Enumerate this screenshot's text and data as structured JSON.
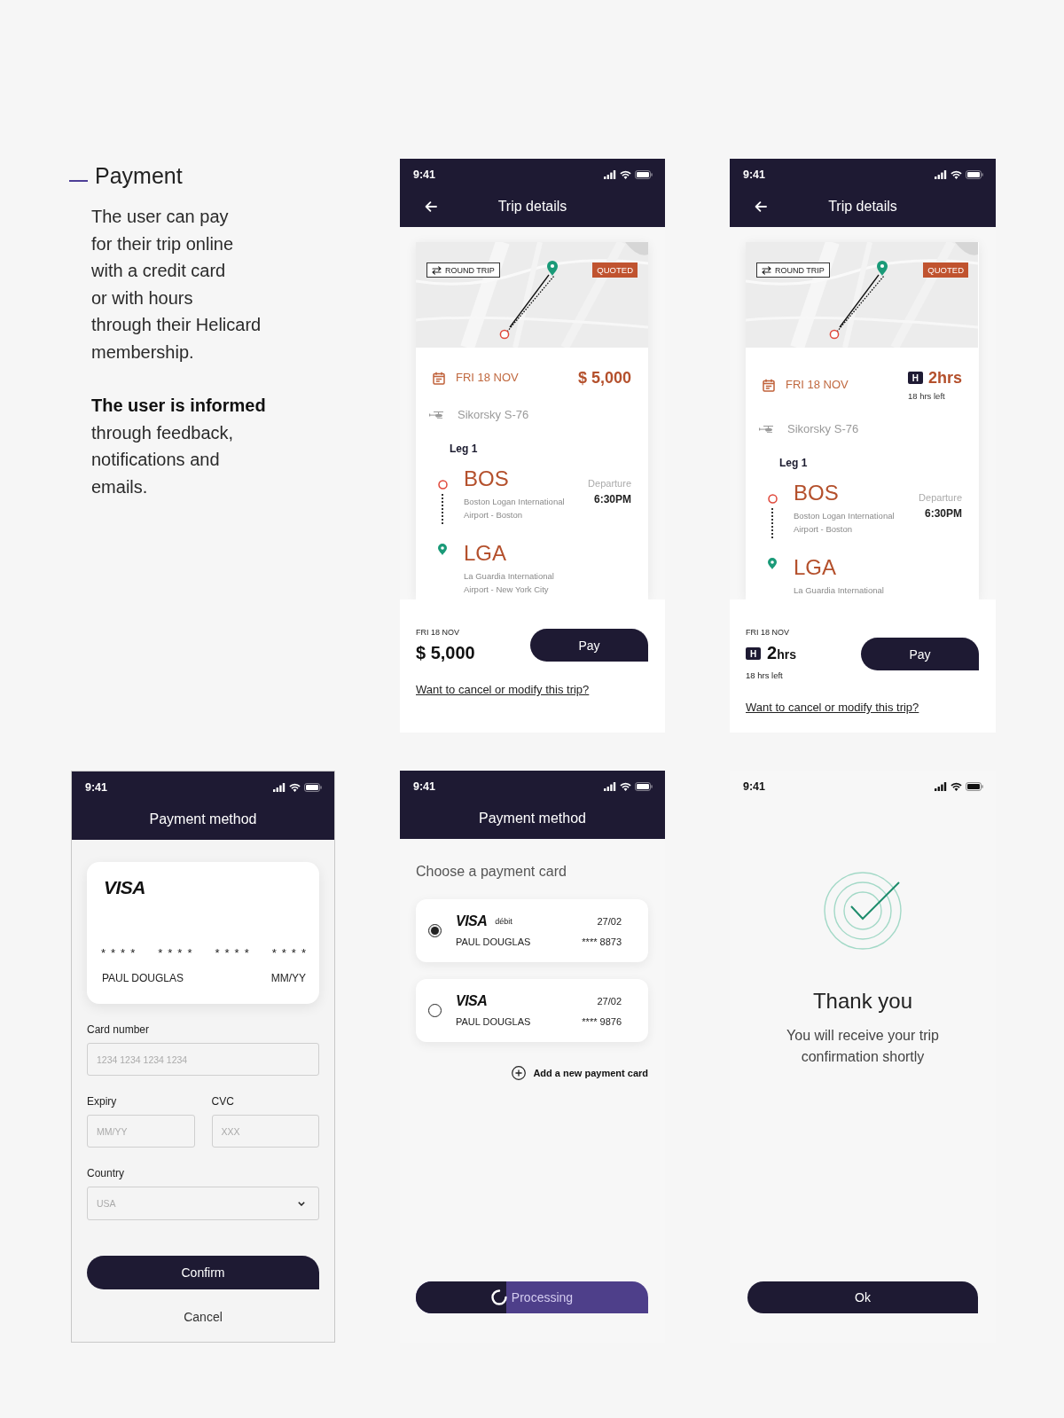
{
  "intro": {
    "title": "Payment",
    "paragraphs": [
      {
        "lines": [
          "The user can pay",
          "for their trip online",
          "with a credit card",
          "or with hours",
          "through their Helicard",
          "membership."
        ]
      },
      {
        "lines": [
          "**The user is informed**",
          "through feedback,",
          "notifications and",
          "emails."
        ]
      }
    ]
  },
  "screens": [
    {
      "kind": "trip_details",
      "status_time": "9:41",
      "title": "Trip details",
      "map": {
        "trip_type": "ROUND TRIP",
        "status": "QUOTED"
      },
      "date": "FRI 18 NOV",
      "cost": {
        "kind": "price",
        "amount": "$ 5,000"
      },
      "aircraft": "Sikorsky S-76",
      "leg": "Leg 1",
      "stops": [
        {
          "kind": "origin",
          "code": "BOS",
          "name_lines": [
            "Boston Logan International",
            "Airport - Boston"
          ],
          "time_label": "Departure",
          "time": "6:30PM"
        },
        {
          "kind": "destination",
          "code": "LGA",
          "name_lines": [
            "La Guardia International",
            "Airport - New York City"
          ]
        }
      ],
      "footer": {
        "date": "FRI 18 NOV",
        "cost": {
          "kind": "price",
          "amount": "$ 5,000"
        },
        "button": "Pay",
        "link": "Want to cancel or modify this trip?"
      }
    },
    {
      "kind": "trip_details",
      "status_time": "9:41",
      "title": "Trip details",
      "map": {
        "trip_type": "ROUND TRIP",
        "status": "QUOTED"
      },
      "date": "FRI 18 NOV",
      "cost": {
        "kind": "hours",
        "badge": "H",
        "value": "2",
        "unit": "hrs",
        "note": "18 hrs left"
      },
      "aircraft": "Sikorsky S-76",
      "leg": "Leg 1",
      "stops": [
        {
          "kind": "origin",
          "code": "BOS",
          "name_lines": [
            "Boston Logan International",
            "Airport - Boston"
          ],
          "time_label": "Departure",
          "time": "6:30PM"
        },
        {
          "kind": "destination",
          "code": "LGA",
          "name_lines": [
            "La Guardia International"
          ]
        }
      ],
      "footer": {
        "date": "FRI 18 NOV",
        "cost": {
          "kind": "hours",
          "badge": "H",
          "value": "2",
          "unit": "hrs",
          "note": "18 hrs left"
        },
        "button": "Pay",
        "link": "Want to cancel or modify this trip?"
      }
    },
    {
      "kind": "card_form",
      "status_time": "9:41",
      "title": "Payment method",
      "card": {
        "brand": "VISA",
        "number_groups": [
          "****",
          "****",
          "****",
          "****"
        ],
        "holder": "PAUL DOUGLAS",
        "expiry": "MM/YY"
      },
      "field_rows": [
        [
          {
            "kind": "text",
            "label": "Card number",
            "placeholder": "1234 1234 1234 1234"
          }
        ],
        [
          {
            "kind": "text",
            "label": "Expiry",
            "placeholder": "MM/YY"
          },
          {
            "kind": "text",
            "label": "CVC",
            "placeholder": "XXX"
          }
        ],
        [
          {
            "kind": "select",
            "label": "Country",
            "placeholder": "USA"
          }
        ]
      ],
      "buttons": [
        {
          "kind": "primary",
          "label": "Confirm"
        },
        {
          "kind": "plain",
          "label": "Cancel"
        }
      ]
    },
    {
      "kind": "card_select",
      "status_time": "9:41",
      "title": "Payment method",
      "prompt": "Choose a payment card",
      "cards": [
        {
          "brand": "VISA",
          "tag": "débit",
          "expiry": "27/02",
          "holder": "PAUL DOUGLAS",
          "number": "**** 8873",
          "selected": true
        },
        {
          "brand": "VISA",
          "expiry": "27/02",
          "holder": "PAUL DOUGLAS",
          "number": "**** 9876",
          "selected": false
        }
      ],
      "add_card": "Add a new payment card",
      "progress_button": {
        "label": "Processing",
        "level": 0.39
      }
    },
    {
      "kind": "confirmation",
      "status_time": "9:41",
      "heading": "Thank you",
      "message": "You will receive your trip confirmation shortly",
      "button": "Ok"
    }
  ]
}
